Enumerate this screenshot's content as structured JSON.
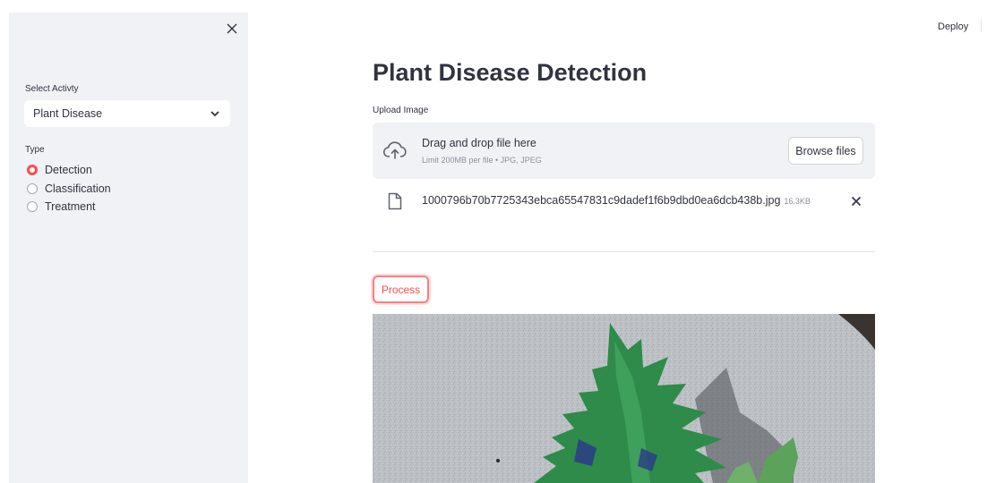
{
  "sidebar": {
    "select_label": "Select Activty",
    "select_value": "Plant Disease",
    "type_label": "Type",
    "radio_options": [
      {
        "label": "Detection",
        "checked": true
      },
      {
        "label": "Classification",
        "checked": false
      },
      {
        "label": "Treatment",
        "checked": false
      }
    ]
  },
  "header": {
    "deploy_label": "Deploy"
  },
  "main": {
    "title": "Plant Disease Detection",
    "upload_label": "Upload Image",
    "dropzone": {
      "title": "Drag and drop file here",
      "limit": "Limit 200MB per file • JPG, JPEG",
      "browse_label": "Browse files"
    },
    "file": {
      "name": "1000796b70b7725343ebca65547831c9dadef1f6b9dbd0ea6dcb438b.jpg",
      "size": "16.3KB"
    },
    "process_label": "Process"
  },
  "colors": {
    "accent": "#ff4b4b",
    "sidebar_bg": "#f0f2f6",
    "text": "#31333f"
  },
  "icons": {
    "close": "close-icon",
    "chevron": "chevron-down-icon",
    "upload": "cloud-upload-icon",
    "file": "file-icon",
    "remove": "remove-file-icon"
  }
}
